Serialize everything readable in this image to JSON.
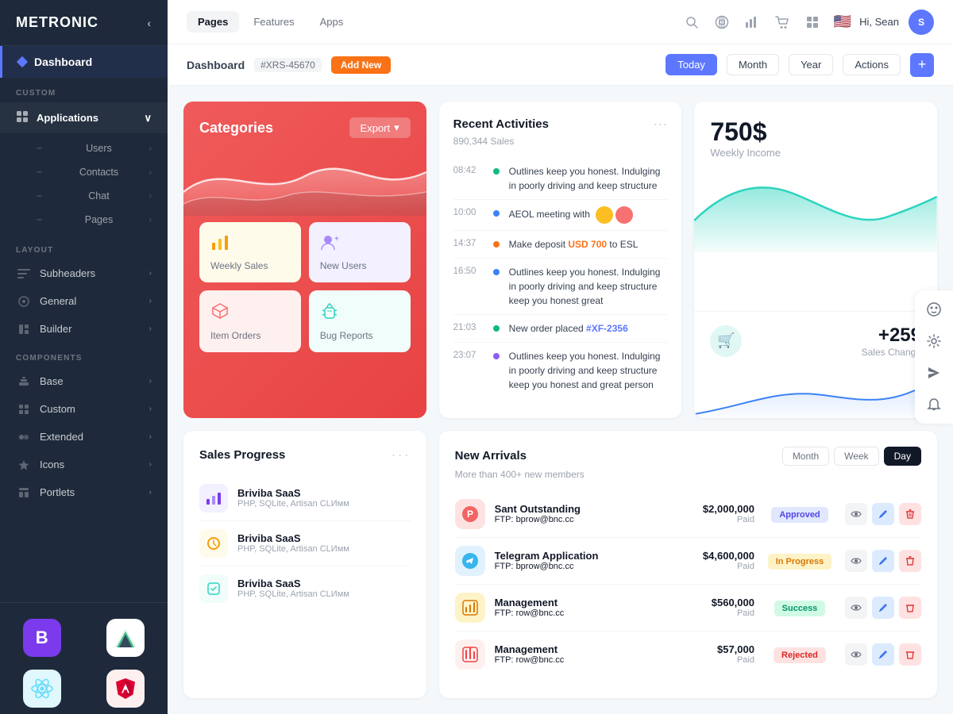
{
  "app": {
    "name": "METRONIC"
  },
  "topnav": {
    "tabs": [
      {
        "label": "Pages",
        "active": true
      },
      {
        "label": "Features",
        "active": false
      },
      {
        "label": "Apps",
        "active": false
      }
    ],
    "user_name": "Hi, Sean",
    "avatar_initial": "S"
  },
  "subnav": {
    "title": "Dashboard",
    "badge": "#XRS-45670",
    "add_label": "Add New",
    "buttons": [
      "Today",
      "Month",
      "Year"
    ],
    "active_button": "Today",
    "actions_label": "Actions"
  },
  "sidebar": {
    "logo": "METRONIC",
    "dashboard_label": "Dashboard",
    "sections": [
      {
        "label": "CUSTOM",
        "items": [
          {
            "label": "Applications",
            "icon": "apps-icon",
            "expandable": true,
            "expanded": true,
            "children": [
              {
                "label": "Users",
                "has_arrow": true
              },
              {
                "label": "Contacts",
                "has_arrow": true
              },
              {
                "label": "Chat",
                "has_arrow": true
              },
              {
                "label": "Pages",
                "has_arrow": true
              }
            ]
          }
        ]
      },
      {
        "label": "LAYOUT",
        "items": [
          {
            "label": "Subheaders",
            "icon": "subheaders-icon",
            "has_arrow": true
          },
          {
            "label": "General",
            "icon": "general-icon",
            "has_arrow": true
          },
          {
            "label": "Builder",
            "icon": "builder-icon",
            "has_arrow": true
          }
        ]
      },
      {
        "label": "COMPONENTS",
        "items": [
          {
            "label": "Base",
            "icon": "base-icon",
            "has_arrow": true
          },
          {
            "label": "Custom",
            "icon": "custom-icon",
            "has_arrow": true
          },
          {
            "label": "Extended",
            "icon": "extended-icon",
            "has_arrow": true
          },
          {
            "label": "Icons",
            "icon": "icons-icon",
            "has_arrow": true
          },
          {
            "label": "Portlets",
            "icon": "portlets-icon",
            "has_arrow": true
          }
        ]
      }
    ]
  },
  "categories": {
    "title": "Categories",
    "export_label": "Export",
    "subcards": [
      {
        "label": "Weekly Sales",
        "color": "yellow"
      },
      {
        "label": "New Users",
        "color": "purple"
      },
      {
        "label": "Item Orders",
        "color": "pink"
      },
      {
        "label": "Bug Reports",
        "color": "teal"
      }
    ]
  },
  "recent_activities": {
    "title": "Recent Activities",
    "subtitle": "890,344 Sales",
    "items": [
      {
        "time": "08:42",
        "dot": "green",
        "text": "Outlines keep you honest. Indulging in poorly driving and keep structure"
      },
      {
        "time": "10:00",
        "dot": "blue",
        "text": "AEOL meeting with",
        "has_avatars": true
      },
      {
        "time": "14:37",
        "dot": "orange",
        "text": "Make deposit ",
        "highlight": "USD 700",
        "text2": " to ESL"
      },
      {
        "time": "16:50",
        "dot": "blue",
        "text": "Outlines keep you honest. Indulging in poorly driving and keep structure keep you honest great"
      },
      {
        "time": "21:03",
        "dot": "green",
        "text": "New order placed ",
        "link": "#XF-2356"
      },
      {
        "time": "23:07",
        "dot": "purple",
        "text": "Outlines keep you honest. Indulging in poorly driving and keep structure keep you honest and great person"
      }
    ]
  },
  "income": {
    "amount": "750$",
    "label": "Weekly Income",
    "sales_change": "+259",
    "sales_label": "Sales Change"
  },
  "sales_progress": {
    "title": "Sales Progress",
    "items": [
      {
        "name": "Briviba SaaS",
        "sub": "PHP, SQLite, Artisan CLИмм",
        "color": "purple"
      },
      {
        "name": "Briviba SaaS",
        "sub": "PHP, SQLite, Artisan CLИмм",
        "color": "yellow"
      },
      {
        "name": "Briviba SaaS",
        "sub": "PHP, SQLite, Artisan CLИмм",
        "color": "teal"
      }
    ]
  },
  "new_arrivals": {
    "title": "New Arrivals",
    "subtitle": "More than 400+ new members",
    "tabs": [
      "Month",
      "Week",
      "Day"
    ],
    "active_tab": "Day",
    "rows": [
      {
        "name": "Sant Outstanding",
        "ftp_label": "FTP:",
        "ftp": "bprow@bnc.cc",
        "amount": "$2,000,000",
        "paid": "Paid",
        "status": "Approved",
        "status_key": "approved"
      },
      {
        "name": "Telegram Application",
        "ftp_label": "FTP:",
        "ftp": "bprow@bnc.cc",
        "amount": "$4,600,000",
        "paid": "Paid",
        "status": "In Progress",
        "status_key": "progress"
      },
      {
        "name": "Management",
        "ftp_label": "FTP:",
        "ftp": "row@bnc.cc",
        "amount": "$560,000",
        "paid": "Paid",
        "status": "Success",
        "status_key": "success"
      },
      {
        "name": "Management",
        "ftp_label": "FTP:",
        "ftp": "row@bnc.cc",
        "amount": "$57,000",
        "paid": "Paid",
        "status": "Rejected",
        "status_key": "rejected"
      }
    ]
  },
  "frameworks": [
    {
      "name": "Bootstrap",
      "symbol": "B",
      "style": "bootstrap"
    },
    {
      "name": "Vue",
      "symbol": "V",
      "style": "vue"
    },
    {
      "name": "React",
      "symbol": "⚛",
      "style": "react"
    },
    {
      "name": "Angular",
      "symbol": "A",
      "style": "angular"
    }
  ]
}
